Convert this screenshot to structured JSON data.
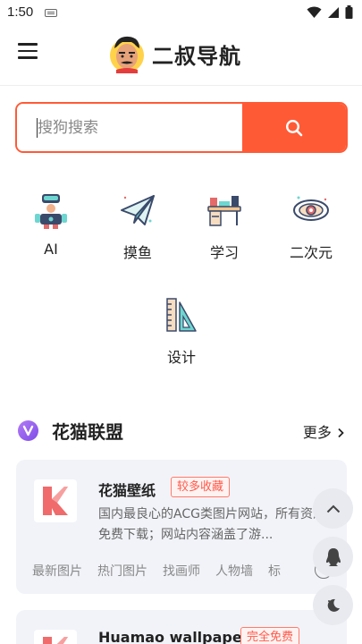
{
  "status_bar": {
    "time": "1:50"
  },
  "header": {
    "app_name": "二叔导航"
  },
  "search": {
    "placeholder": "搜狗搜索"
  },
  "categories": [
    {
      "label": "AI",
      "icon": "robot-icon"
    },
    {
      "label": "摸鱼",
      "icon": "paper-plane-icon"
    },
    {
      "label": "学习",
      "icon": "desk-icon"
    },
    {
      "label": "二次元",
      "icon": "planet-icon"
    },
    {
      "label": "设计",
      "icon": "ruler-triangle-icon"
    }
  ],
  "section": {
    "title": "花猫联盟",
    "more_label": "更多"
  },
  "cards": [
    {
      "title": "花猫壁纸",
      "tag": "较多收藏",
      "description": "国内最良心的ACG类图片网站，所有资源免费下载；网站内容涵盖了游...",
      "links": [
        "最新图片",
        "热门图片",
        "找画师",
        "人物墙",
        "标"
      ]
    },
    {
      "title": "Huamao wallpaper",
      "tag": "完全免费"
    }
  ],
  "colors": {
    "accent": "#ff5a36",
    "card_bg": "#f1f3f8",
    "tag_red": "#ff5a4b"
  }
}
